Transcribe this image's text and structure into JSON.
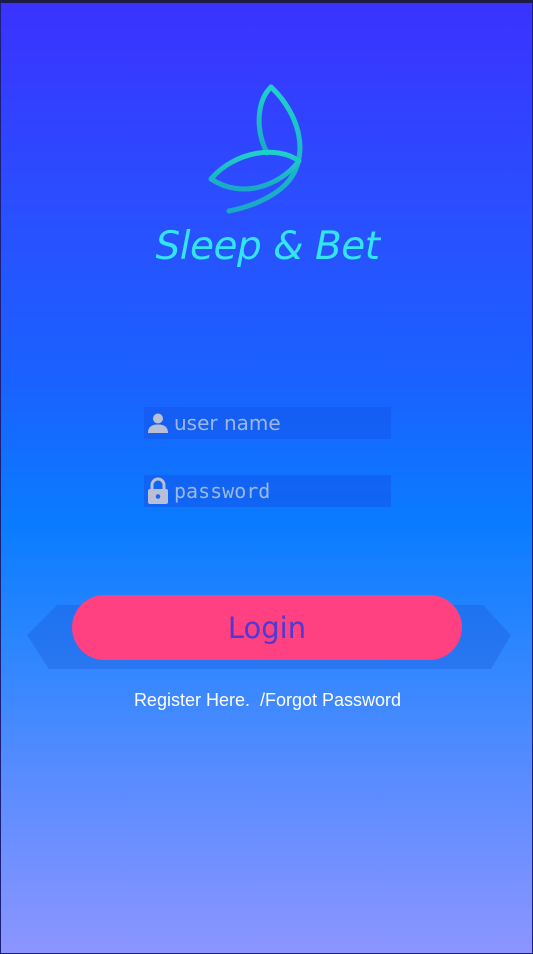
{
  "app": {
    "brand_name": "Sleep & Bet"
  },
  "login_form": {
    "username_placeholder": "user name",
    "password_placeholder": "password",
    "login_label": "Login"
  },
  "links": {
    "register_label": "Register Here.",
    "forgot_password_label": "/Forgot Password"
  },
  "icons": {
    "logo": "leaf-logo-icon",
    "username": "person-icon",
    "password": "lock-icon"
  },
  "colors": {
    "background_top": "#3a32ff",
    "background_bottom": "#8c95ff",
    "brand_text": "#33e6ee",
    "logo_stroke": "#1fc6c6",
    "login_button": "#ff4081",
    "login_text": "#4b3bd6",
    "field_background": "#1455eb",
    "icon": "#b8bfd6"
  }
}
